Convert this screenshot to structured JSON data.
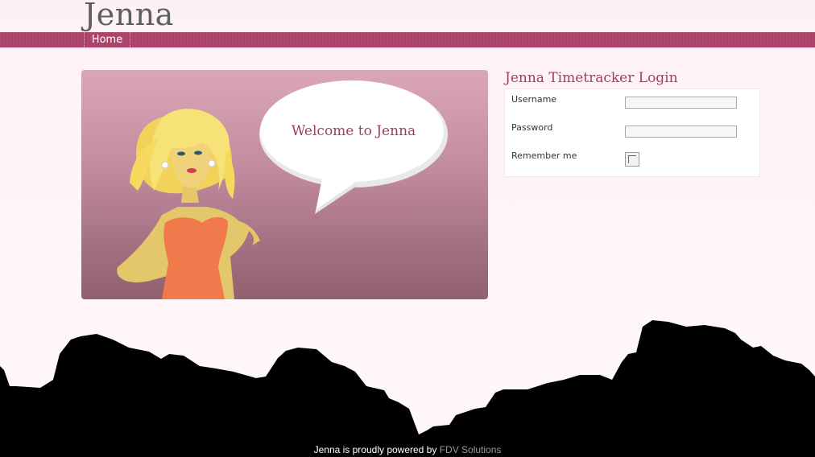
{
  "site": {
    "title": "Jenna"
  },
  "nav": {
    "items": [
      {
        "label": "Home"
      }
    ]
  },
  "banner": {
    "welcome_text": "Welcome to Jenna"
  },
  "login": {
    "title": "Jenna Timetracker Login",
    "username_label": "Username",
    "username_value": "",
    "password_label": "Password",
    "password_value": "",
    "remember_label": "Remember me",
    "remember_checked": false
  },
  "footer": {
    "text": "Jenna is proudly powered by",
    "link_text": "FDV Solutions"
  },
  "colors": {
    "accent": "#a33c6a",
    "navbar": "#b0476f",
    "page_bg": "#fff5f9"
  }
}
